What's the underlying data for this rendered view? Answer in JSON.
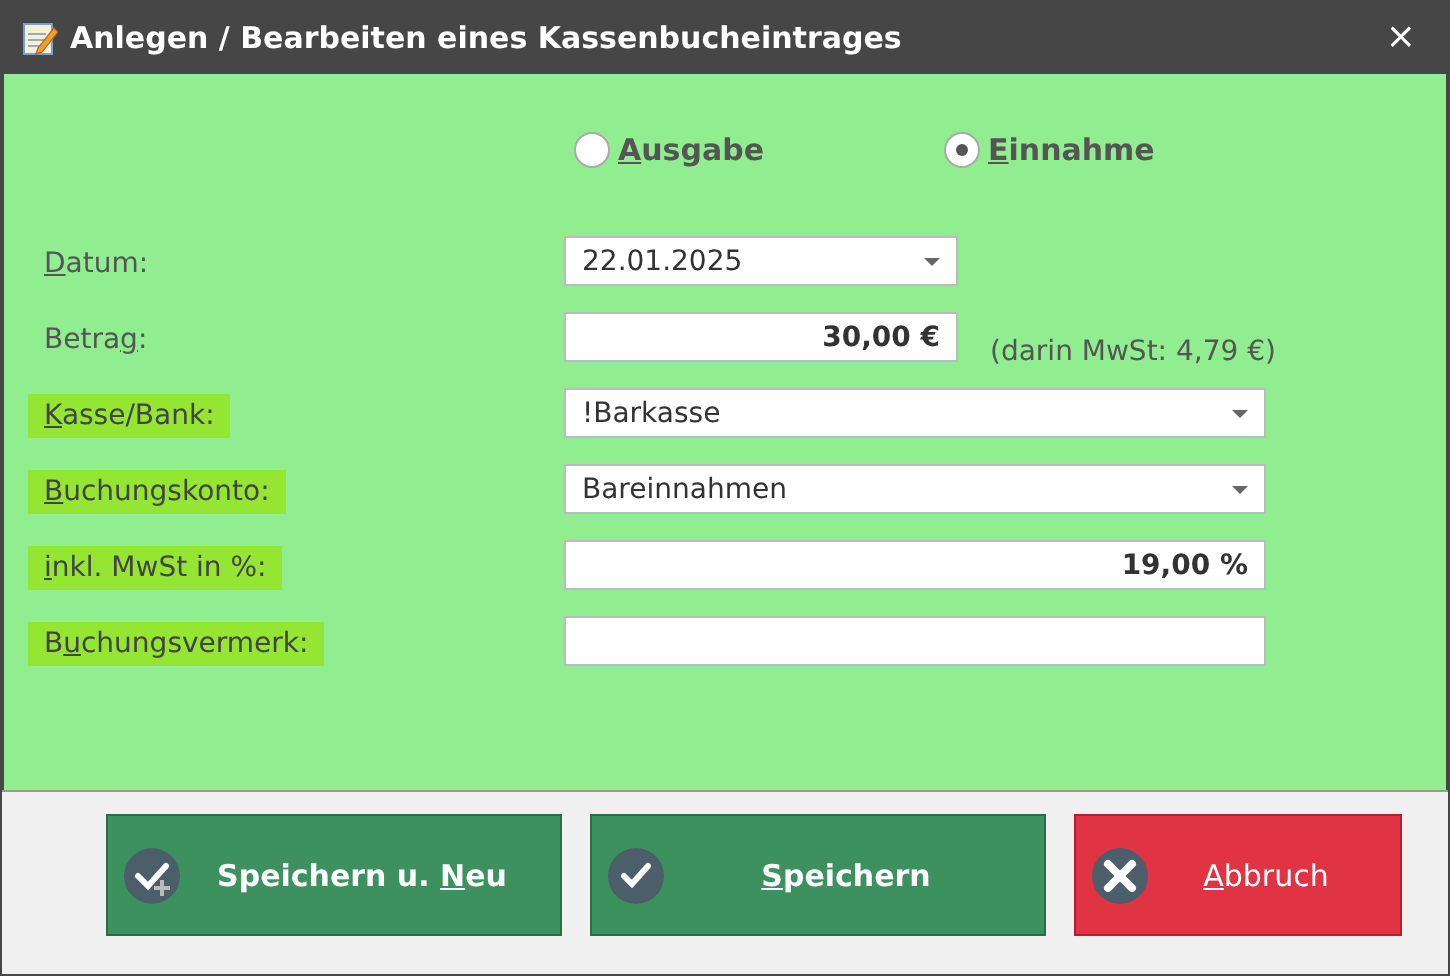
{
  "window": {
    "title": "Anlegen / Bearbeiten eines Kassenbucheintrages",
    "close": "×"
  },
  "type_options": [
    {
      "label": [
        {
          "text": "A",
          "underlined": true
        },
        {
          "text": "usgabe",
          "underlined": false
        }
      ],
      "selected": false
    },
    {
      "label": [
        {
          "text": "E",
          "underlined": true
        },
        {
          "text": "innahme",
          "underlined": false
        }
      ],
      "selected": true
    }
  ],
  "fields": [
    {
      "label": [
        {
          "text": "D",
          "underlined": true
        },
        {
          "text": "atum:",
          "underlined": false
        }
      ],
      "highlighted": false,
      "kind": "dropdown",
      "value": "22.01.2025",
      "wide": false
    },
    {
      "label": [
        {
          "text": "Betra",
          "underlined": false
        },
        {
          "text": "g",
          "underlined": true
        },
        {
          "text": ":",
          "underlined": false
        }
      ],
      "highlighted": false,
      "kind": "amount",
      "value": "30,00 €",
      "note": "(darin MwSt: 4,79 €)",
      "wide": false
    },
    {
      "label": [
        {
          "text": "K",
          "underlined": true
        },
        {
          "text": "asse/Bank:",
          "underlined": false
        }
      ],
      "highlighted": true,
      "kind": "dropdown",
      "value": "!Barkasse",
      "wide": true
    },
    {
      "label": [
        {
          "text": "B",
          "underlined": true
        },
        {
          "text": "uchungskonto:",
          "underlined": false
        }
      ],
      "highlighted": true,
      "kind": "dropdown",
      "value": "Bareinnahmen",
      "wide": true
    },
    {
      "label": [
        {
          "text": "i",
          "underlined": true
        },
        {
          "text": "nkl. MwSt in %:",
          "underlined": false
        }
      ],
      "highlighted": true,
      "kind": "amount",
      "value": "19,00 %",
      "wide": true
    },
    {
      "label": [
        {
          "text": "B",
          "underlined": false
        },
        {
          "text": "u",
          "underlined": true
        },
        {
          "text": "chungsvermerk:",
          "underlined": false
        }
      ],
      "highlighted": true,
      "kind": "text",
      "wide": true
    }
  ],
  "buttons": [
    {
      "label": [
        {
          "text": "Speichern u. ",
          "underlined": false
        },
        {
          "text": "N",
          "underlined": true
        },
        {
          "text": "eu",
          "underlined": false
        }
      ],
      "kind": "save_new"
    },
    {
      "label": [
        {
          "text": "S",
          "underlined": true
        },
        {
          "text": "peichern",
          "underlined": false
        }
      ],
      "kind": "save"
    },
    {
      "label": [
        {
          "text": "A",
          "underlined": true
        },
        {
          "text": "bbruch",
          "underlined": false
        }
      ],
      "kind": "cancel"
    }
  ]
}
